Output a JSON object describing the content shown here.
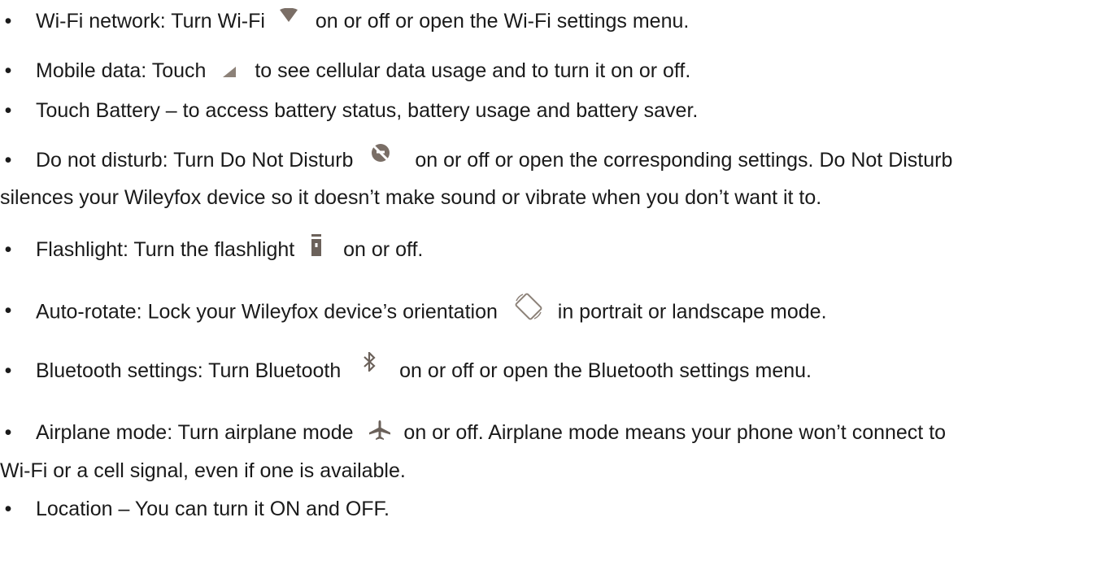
{
  "bullet": "•",
  "items": [
    {
      "before": "Wi-Fi network: Turn Wi-Fi",
      "icon": "wifi-icon",
      "after": "on or off or open the Wi-Fi settings menu."
    },
    {
      "before": "Mobile data: Touch",
      "icon": "signal-icon",
      "after": "to see cellular data usage and to turn it on or off."
    },
    {
      "text": "Touch Battery – to access battery status, battery usage and battery saver."
    },
    {
      "before": "Do not disturb: Turn Do Not Disturb",
      "icon": "do-not-disturb-icon",
      "after": "on or off or open the corresponding settings. Do Not Disturb",
      "continuation": "silences your Wileyfox device so it doesn’t make sound or vibrate when you don’t want it to."
    },
    {
      "before": "Flashlight: Turn the flashlight",
      "icon": "flashlight-icon",
      "after": "on or off."
    },
    {
      "before": "Auto-rotate: Lock your Wileyfox device’s orientation",
      "icon": "auto-rotate-icon",
      "after": "in portrait or landscape mode."
    },
    {
      "before": "Bluetooth settings: Turn Bluetooth",
      "icon": "bluetooth-icon",
      "after": "on or off or open the Bluetooth settings menu."
    },
    {
      "before": "Airplane mode: Turn airplane mode",
      "icon": "airplane-icon",
      "after": "on or off. Airplane mode means your phone won’t connect to",
      "continuation": "Wi-Fi or a cell signal, even if one is available."
    },
    {
      "text": "Location – You can turn it ON and OFF."
    }
  ],
  "colors": {
    "text": "#1a1a1a",
    "icon": "#7a6e66"
  }
}
